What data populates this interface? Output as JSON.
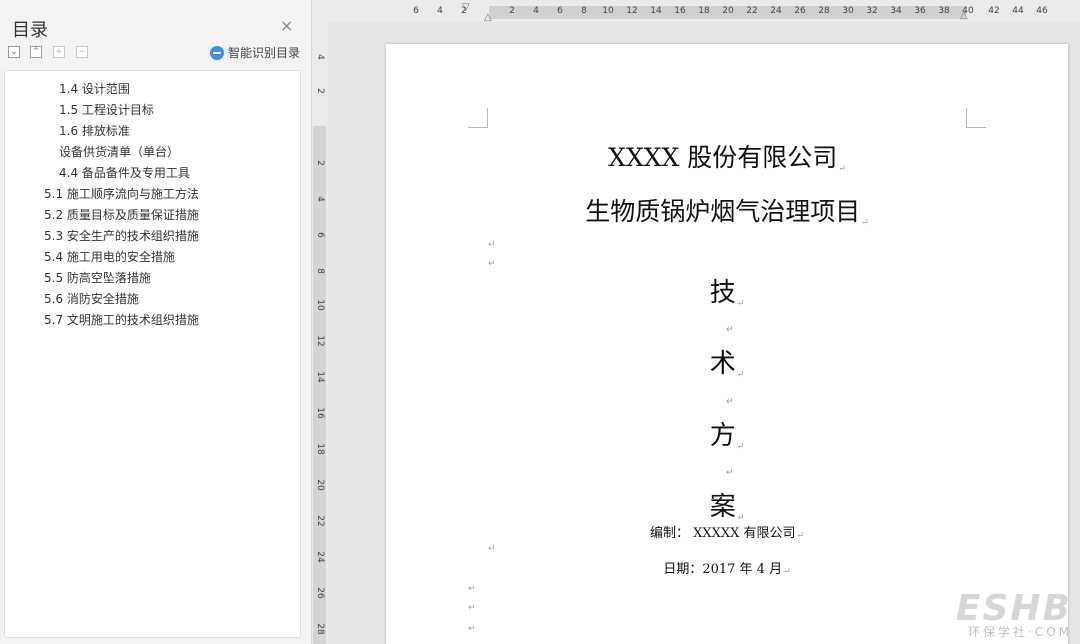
{
  "toc": {
    "title": "目录",
    "close": "×",
    "smart_label": "智能识别目录",
    "buttons": {
      "expand": "⌄",
      "collapse": "⌃",
      "add": "+",
      "remove": "−"
    },
    "items": [
      "1.4 设计范围",
      "1.5 工程设计目标",
      "1.6  排放标准",
      "设备供货清单（单台）",
      "4.4 备品备件及专用工具",
      "5.1 施工顺序流向与施工方法",
      "5.2 质量目标及质量保证措施",
      "5.3 安全生产的技术组织措施",
      "5.4 施工用电的安全措施",
      "5.5 防高空坠落措施",
      "5.6 消防安全措施",
      "5.7 文明施工的技术组织措施"
    ]
  },
  "ruler": {
    "horizontal": [
      "6",
      "4",
      "2",
      "2",
      "4",
      "6",
      "8",
      "10",
      "12",
      "14",
      "16",
      "18",
      "20",
      "22",
      "24",
      "26",
      "28",
      "30",
      "32",
      "34",
      "36",
      "38",
      "40",
      "42",
      "44",
      "46"
    ],
    "vertical": [
      "4",
      "2",
      "2",
      "4",
      "6",
      "8",
      "10",
      "12",
      "14",
      "16",
      "18",
      "20",
      "22",
      "24",
      "26",
      "28"
    ]
  },
  "document": {
    "company": "XXXX 股份有限公司",
    "project": "生物质锅炉烟气治理项目",
    "title_chars": [
      "技",
      "术",
      "方",
      "案"
    ],
    "compiler": "编制： XXXXX 有限公司",
    "date": "日期：2017 年 4 月",
    "para_mark": "↵"
  },
  "watermark": {
    "logo": "ESHB",
    "subtitle": "环保学社·COM"
  }
}
